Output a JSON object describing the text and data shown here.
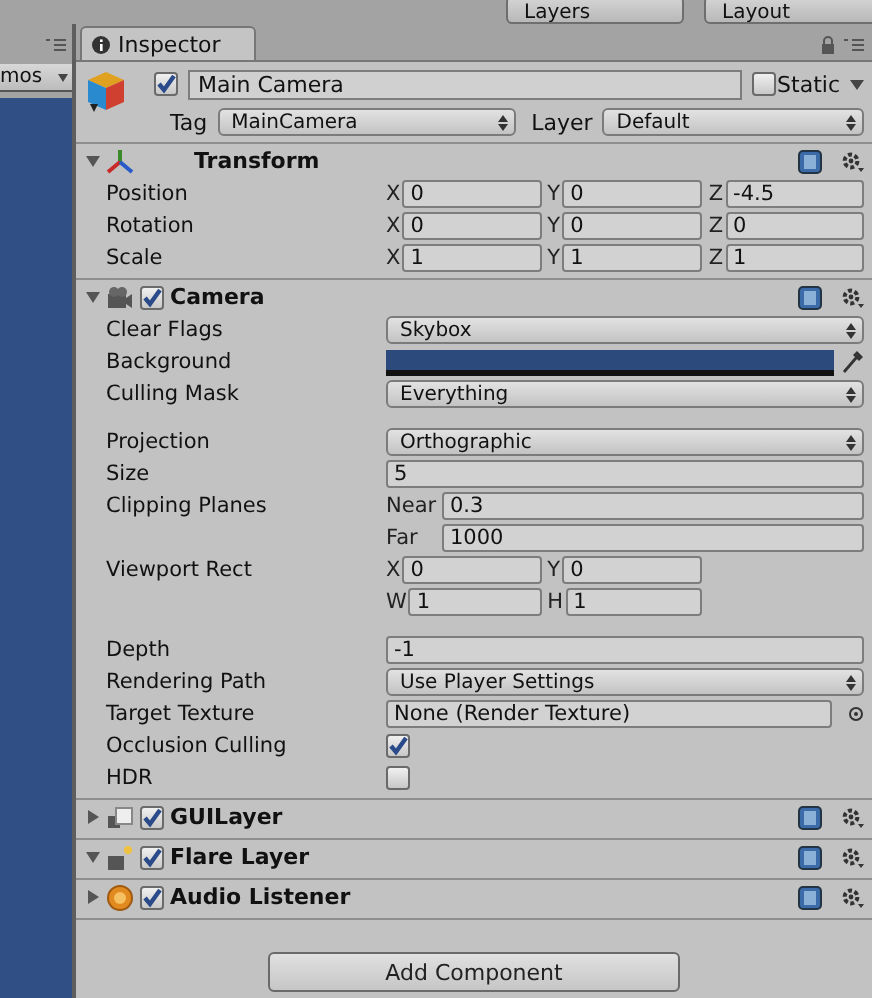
{
  "toolbar": {
    "layers": "Layers",
    "layout": "Layout"
  },
  "left_panel": {
    "tab": "mos"
  },
  "tab": {
    "label": "Inspector"
  },
  "object": {
    "active": true,
    "name": "Main Camera",
    "static": false,
    "static_label": "Static",
    "tag_label": "Tag",
    "tag": "MainCamera",
    "layer_label": "Layer",
    "layer": "Default"
  },
  "components": [
    {
      "kind": "transform",
      "title": "Transform",
      "expanded": true,
      "properties": [
        {
          "kind": "vector",
          "label": "Position",
          "fields": [
            {
              "axis": "X",
              "value": "0"
            },
            {
              "axis": "Y",
              "value": "0"
            },
            {
              "axis": "Z",
              "value": "-4.5"
            }
          ]
        },
        {
          "kind": "vector",
          "label": "Rotation",
          "fields": [
            {
              "axis": "X",
              "value": "0"
            },
            {
              "axis": "Y",
              "value": "0"
            },
            {
              "axis": "Z",
              "value": "0"
            }
          ]
        },
        {
          "kind": "vector",
          "label": "Scale",
          "fields": [
            {
              "axis": "X",
              "value": "1"
            },
            {
              "axis": "Y",
              "value": "1"
            },
            {
              "axis": "Z",
              "value": "1"
            }
          ]
        }
      ]
    },
    {
      "kind": "camera",
      "title": "Camera",
      "expanded": true,
      "enabled": true,
      "properties": [
        {
          "kind": "dropdown",
          "label": "Clear Flags",
          "value": "Skybox"
        },
        {
          "kind": "color",
          "label": "Background",
          "color": "#2d4a7c"
        },
        {
          "kind": "dropdown",
          "label": "Culling Mask",
          "value": "Everything"
        },
        {
          "kind": "dropdown",
          "label": "Projection",
          "value": "Orthographic",
          "gap_before": true
        },
        {
          "kind": "text",
          "label": "Size",
          "value": "5"
        },
        {
          "kind": "stack",
          "label": "Clipping Planes",
          "fields": [
            {
              "axis": "Near",
              "value": "0.3"
            },
            {
              "axis": "Far",
              "value": "1000"
            }
          ]
        },
        {
          "kind": "rect",
          "label": "Viewport Rect",
          "fields": [
            {
              "axis": "X",
              "value": "0"
            },
            {
              "axis": "Y",
              "value": "0"
            },
            {
              "axis": "W",
              "value": "1"
            },
            {
              "axis": "H",
              "value": "1"
            }
          ]
        },
        {
          "kind": "text",
          "label": "Depth",
          "value": "-1",
          "gap_before": true
        },
        {
          "kind": "dropdown",
          "label": "Rendering Path",
          "value": "Use Player Settings"
        },
        {
          "kind": "object",
          "label": "Target Texture",
          "value": "None (Render Texture)"
        },
        {
          "kind": "checkbox",
          "label": "Occlusion Culling",
          "checked": true
        },
        {
          "kind": "checkbox",
          "label": "HDR",
          "checked": false
        }
      ]
    },
    {
      "kind": "guilayer",
      "title": "GUILayer",
      "expanded": false,
      "enabled": true
    },
    {
      "kind": "flare",
      "title": "Flare Layer",
      "expanded": true,
      "enabled": true
    },
    {
      "kind": "audio",
      "title": "Audio Listener",
      "expanded": false,
      "enabled": true
    }
  ],
  "add_component": "Add Component"
}
